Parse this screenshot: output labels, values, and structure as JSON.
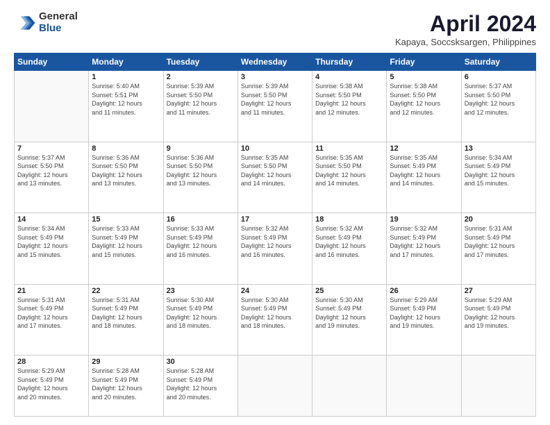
{
  "logo": {
    "general": "General",
    "blue": "Blue"
  },
  "header": {
    "title": "April 2024",
    "subtitle": "Kapaya, Soccsksargen, Philippines"
  },
  "days_of_week": [
    "Sunday",
    "Monday",
    "Tuesday",
    "Wednesday",
    "Thursday",
    "Friday",
    "Saturday"
  ],
  "weeks": [
    [
      {
        "day": "",
        "info": ""
      },
      {
        "day": "1",
        "info": "Sunrise: 5:40 AM\nSunset: 5:51 PM\nDaylight: 12 hours\nand 11 minutes."
      },
      {
        "day": "2",
        "info": "Sunrise: 5:39 AM\nSunset: 5:50 PM\nDaylight: 12 hours\nand 11 minutes."
      },
      {
        "day": "3",
        "info": "Sunrise: 5:39 AM\nSunset: 5:50 PM\nDaylight: 12 hours\nand 11 minutes."
      },
      {
        "day": "4",
        "info": "Sunrise: 5:38 AM\nSunset: 5:50 PM\nDaylight: 12 hours\nand 12 minutes."
      },
      {
        "day": "5",
        "info": "Sunrise: 5:38 AM\nSunset: 5:50 PM\nDaylight: 12 hours\nand 12 minutes."
      },
      {
        "day": "6",
        "info": "Sunrise: 5:37 AM\nSunset: 5:50 PM\nDaylight: 12 hours\nand 12 minutes."
      }
    ],
    [
      {
        "day": "7",
        "info": "Sunrise: 5:37 AM\nSunset: 5:50 PM\nDaylight: 12 hours\nand 13 minutes."
      },
      {
        "day": "8",
        "info": "Sunrise: 5:36 AM\nSunset: 5:50 PM\nDaylight: 12 hours\nand 13 minutes."
      },
      {
        "day": "9",
        "info": "Sunrise: 5:36 AM\nSunset: 5:50 PM\nDaylight: 12 hours\nand 13 minutes."
      },
      {
        "day": "10",
        "info": "Sunrise: 5:35 AM\nSunset: 5:50 PM\nDaylight: 12 hours\nand 14 minutes."
      },
      {
        "day": "11",
        "info": "Sunrise: 5:35 AM\nSunset: 5:50 PM\nDaylight: 12 hours\nand 14 minutes."
      },
      {
        "day": "12",
        "info": "Sunrise: 5:35 AM\nSunset: 5:49 PM\nDaylight: 12 hours\nand 14 minutes."
      },
      {
        "day": "13",
        "info": "Sunrise: 5:34 AM\nSunset: 5:49 PM\nDaylight: 12 hours\nand 15 minutes."
      }
    ],
    [
      {
        "day": "14",
        "info": "Sunrise: 5:34 AM\nSunset: 5:49 PM\nDaylight: 12 hours\nand 15 minutes."
      },
      {
        "day": "15",
        "info": "Sunrise: 5:33 AM\nSunset: 5:49 PM\nDaylight: 12 hours\nand 15 minutes."
      },
      {
        "day": "16",
        "info": "Sunrise: 5:33 AM\nSunset: 5:49 PM\nDaylight: 12 hours\nand 16 minutes."
      },
      {
        "day": "17",
        "info": "Sunrise: 5:32 AM\nSunset: 5:49 PM\nDaylight: 12 hours\nand 16 minutes."
      },
      {
        "day": "18",
        "info": "Sunrise: 5:32 AM\nSunset: 5:49 PM\nDaylight: 12 hours\nand 16 minutes."
      },
      {
        "day": "19",
        "info": "Sunrise: 5:32 AM\nSunset: 5:49 PM\nDaylight: 12 hours\nand 17 minutes."
      },
      {
        "day": "20",
        "info": "Sunrise: 5:31 AM\nSunset: 5:49 PM\nDaylight: 12 hours\nand 17 minutes."
      }
    ],
    [
      {
        "day": "21",
        "info": "Sunrise: 5:31 AM\nSunset: 5:49 PM\nDaylight: 12 hours\nand 17 minutes."
      },
      {
        "day": "22",
        "info": "Sunrise: 5:31 AM\nSunset: 5:49 PM\nDaylight: 12 hours\nand 18 minutes."
      },
      {
        "day": "23",
        "info": "Sunrise: 5:30 AM\nSunset: 5:49 PM\nDaylight: 12 hours\nand 18 minutes."
      },
      {
        "day": "24",
        "info": "Sunrise: 5:30 AM\nSunset: 5:49 PM\nDaylight: 12 hours\nand 18 minutes."
      },
      {
        "day": "25",
        "info": "Sunrise: 5:30 AM\nSunset: 5:49 PM\nDaylight: 12 hours\nand 19 minutes."
      },
      {
        "day": "26",
        "info": "Sunrise: 5:29 AM\nSunset: 5:49 PM\nDaylight: 12 hours\nand 19 minutes."
      },
      {
        "day": "27",
        "info": "Sunrise: 5:29 AM\nSunset: 5:49 PM\nDaylight: 12 hours\nand 19 minutes."
      }
    ],
    [
      {
        "day": "28",
        "info": "Sunrise: 5:29 AM\nSunset: 5:49 PM\nDaylight: 12 hours\nand 20 minutes."
      },
      {
        "day": "29",
        "info": "Sunrise: 5:28 AM\nSunset: 5:49 PM\nDaylight: 12 hours\nand 20 minutes."
      },
      {
        "day": "30",
        "info": "Sunrise: 5:28 AM\nSunset: 5:49 PM\nDaylight: 12 hours\nand 20 minutes."
      },
      {
        "day": "",
        "info": ""
      },
      {
        "day": "",
        "info": ""
      },
      {
        "day": "",
        "info": ""
      },
      {
        "day": "",
        "info": ""
      }
    ]
  ]
}
